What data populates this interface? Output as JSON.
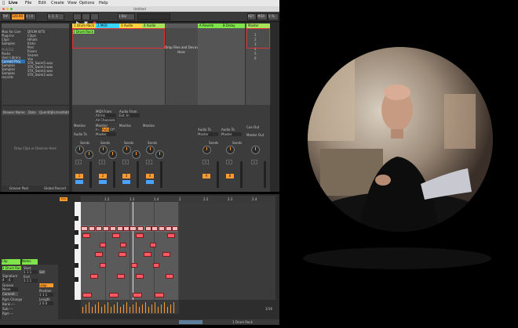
{
  "menubar": {
    "items": [
      "Live",
      "File",
      "Edit",
      "Create",
      "View",
      "Options",
      "Help"
    ]
  },
  "window": {
    "title": "Untitled"
  },
  "transport": {
    "tap": "TAP",
    "bpm": "120.00",
    "time_sig": "4 / 4",
    "position": "1.  1.  1",
    "zoom": "1 Bar",
    "key": "KEY",
    "midi": "MIDI",
    "cpu": "0 %"
  },
  "browser": {
    "collections": [
      "Max for Live",
      "Plug-ins",
      "Clips",
      "Samples"
    ],
    "places_header": "PLACES",
    "places": [
      "Packs",
      "User Library",
      "Current Proj",
      "Samples",
      "Samples",
      "Samples",
      "records"
    ],
    "files": [
      "DRUM KITS",
      "Claps",
      "Hihats",
      "Kicks",
      "Perc",
      "Risers",
      "Snares",
      "Vox",
      "STK_Swim5.wav",
      "STK_Swim3.wav",
      "STK_Swim4.wav",
      "STK_Swim2.wav"
    ],
    "columns": [
      "Browse Name",
      "Date",
      "Quantity",
      "Format",
      "Add"
    ],
    "drop_text": "Drop Clips or Devices Here",
    "footer_left": "Groove Pool",
    "footer_right": "Global Record"
  },
  "session": {
    "tracks": [
      {
        "name": "1 Drum Rack",
        "color": "#ffd440"
      },
      {
        "name": "2 MIDI",
        "color": "#39d5ff"
      },
      {
        "name": "3 Audio",
        "color": "#ffd440"
      },
      {
        "name": "4 Audio",
        "color": "#a7e35a"
      },
      {
        "name": "A Reverb",
        "color": "#7ee44a"
      },
      {
        "name": "B Delay",
        "color": "#7ee44a"
      },
      {
        "name": "Master",
        "color": "#a7e35a"
      }
    ],
    "playing_clip": "1 Drum Rack",
    "drop_text": "Drop Files and Devices Here",
    "drop_sub": "Here",
    "scene_numbers": [
      "1",
      "2",
      "3",
      "4",
      "5",
      "6"
    ]
  },
  "mixer": {
    "midi_from": "MIDI From",
    "all_ins": "All Ins",
    "all_channels": "All Channels",
    "audio_from": "Audio From",
    "ext_in": "Ext. In",
    "monitor": "Monitor",
    "monitor_opts": [
      "In",
      "Auto",
      "Off"
    ],
    "audio_to": "Audio To",
    "master": "Master",
    "cue_out": "Cue Out",
    "master_out": "Master Out",
    "sends": "Sends",
    "track_numbers": [
      "1",
      "2",
      "3",
      "4",
      "A",
      "B"
    ],
    "volume_values": [
      "0",
      "0",
      "0",
      "0",
      "0",
      "0",
      "0"
    ]
  },
  "clip": {
    "header": "Clip",
    "name": "1 Drum Rack",
    "notes_label": "Notes",
    "fields": [
      "Signature",
      "4",
      "4",
      "Groove",
      "None",
      "Commit",
      "Start",
      "1 1 1",
      "Set",
      "End",
      "3 1 1",
      "Loop",
      "Position",
      "1 1 1",
      "Length",
      "2 0 0",
      "Pgm Change",
      "Bank ---",
      "Sub ---",
      "Pgm ---"
    ],
    "ruler": [
      "1",
      "1.2",
      "1.3",
      "1.4",
      "2",
      "2.2",
      "2.3",
      "2.4"
    ],
    "fold": "Fold",
    "page": "1/16"
  },
  "statusbar": {
    "right": "1 Drum Rack"
  },
  "colors": {
    "orange": "#ff9a2e",
    "note": "#ff5a63",
    "green": "#7ee44a",
    "blue": "#39d5ff",
    "yellow": "#ffd440"
  }
}
